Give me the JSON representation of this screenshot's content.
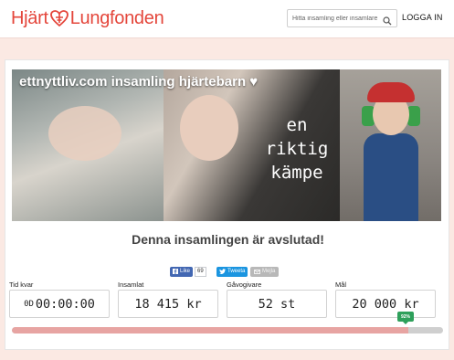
{
  "header": {
    "logo_left": "Hjärt",
    "logo_right": "Lungfonden",
    "search_placeholder": "Hitta insamling eller insamlare",
    "login_label": "LOGGA IN"
  },
  "hero": {
    "title": "ettnyttliv.com insamling hjärtebarn ♥",
    "overlay_line1": "en riktig",
    "overlay_line2": "kämpe"
  },
  "status_text": "Denna insamlingen är avslutad!",
  "share": {
    "like_label": "Like",
    "like_count": "69",
    "tweet_label": "Tweeta",
    "mail_label": "Mejla"
  },
  "stats": {
    "time_left": {
      "label": "Tid kvar",
      "prefix": "0D",
      "value": "00:00:00"
    },
    "collected": {
      "label": "Insamlat",
      "value": "18 415 kr"
    },
    "donors": {
      "label": "Gåvogivare",
      "value": "52 st"
    },
    "goal": {
      "label": "Mål",
      "value": "20 000 kr"
    }
  },
  "progress": {
    "percent": 92,
    "badge": "92%"
  },
  "colors": {
    "brand": "#e4463b",
    "background": "#fbe9e3",
    "progress_fill": "#e7a4a2",
    "badge": "#2ea05b"
  }
}
